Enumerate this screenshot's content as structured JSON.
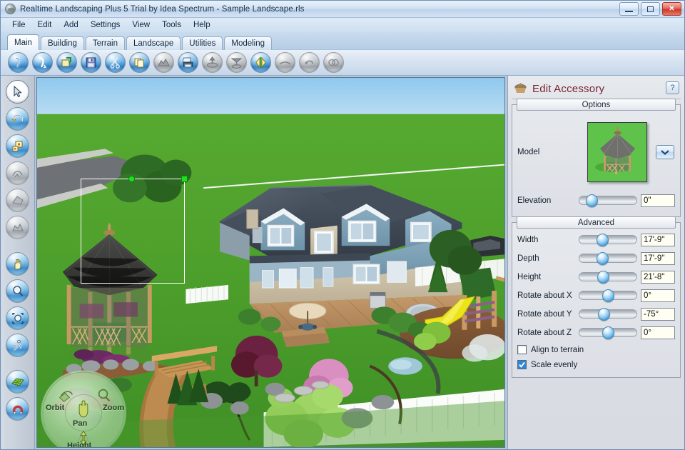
{
  "window": {
    "title": "Realtime Landscaping Plus 5 Trial by Idea Spectrum - Sample Landscape.rls",
    "app_icon": "globe-icon",
    "minimize_label": "Minimize",
    "maximize_label": "Maximize",
    "close_label": "✕"
  },
  "menu": {
    "items": [
      {
        "label": "File"
      },
      {
        "label": "Edit"
      },
      {
        "label": "Add"
      },
      {
        "label": "Settings"
      },
      {
        "label": "View"
      },
      {
        "label": "Tools"
      },
      {
        "label": "Help"
      }
    ]
  },
  "tabs": {
    "active": "Main",
    "items": [
      {
        "label": "Main",
        "active": true
      },
      {
        "label": "Building",
        "active": false
      },
      {
        "label": "Terrain",
        "active": false
      },
      {
        "label": "Landscape",
        "active": false
      },
      {
        "label": "Utilities",
        "active": false
      },
      {
        "label": "Modeling",
        "active": false
      }
    ]
  },
  "toolbar": {
    "buttons": [
      {
        "name": "new-project-icon",
        "tip": "New",
        "enabled": true
      },
      {
        "name": "open-project-icon",
        "tip": "Open",
        "enabled": true
      },
      {
        "name": "import-icon",
        "tip": "Import",
        "enabled": true
      },
      {
        "name": "save-icon",
        "tip": "Save",
        "enabled": true
      },
      {
        "name": "cut-icon",
        "tip": "Cut",
        "enabled": true
      },
      {
        "name": "copy-icon",
        "tip": "Copy",
        "enabled": true
      },
      {
        "name": "paste-icon",
        "tip": "Paste",
        "enabled": false
      },
      {
        "name": "print-icon",
        "tip": "Print",
        "enabled": true
      },
      {
        "name": "raise-object-icon",
        "tip": "Raise",
        "enabled": false
      },
      {
        "name": "lower-object-icon",
        "tip": "Lower",
        "enabled": false
      },
      {
        "name": "mirror-icon",
        "tip": "Mirror",
        "enabled": true
      },
      {
        "name": "flatten-icon",
        "tip": "Flatten",
        "enabled": false
      },
      {
        "name": "undo-icon",
        "tip": "Undo",
        "enabled": false
      },
      {
        "name": "redo-icon",
        "tip": "Redo",
        "enabled": false
      }
    ]
  },
  "tool_rail": {
    "buttons": [
      {
        "name": "select-arrow-tool",
        "state": "selected"
      },
      {
        "name": "rotate-tool",
        "state": "enabled"
      },
      {
        "name": "copy-object-tool",
        "state": "enabled"
      },
      {
        "name": "draw-region-tool",
        "state": "disabled"
      },
      {
        "name": "polygon-tool",
        "state": "disabled"
      },
      {
        "name": "freeform-tool",
        "state": "disabled"
      },
      {
        "name": "pan-hand-tool",
        "state": "enabled"
      },
      {
        "name": "zoom-tool",
        "state": "enabled"
      },
      {
        "name": "zoom-extents-tool",
        "state": "enabled"
      },
      {
        "name": "walkthrough-tool",
        "state": "enabled"
      },
      {
        "name": "grid-tool",
        "state": "enabled"
      },
      {
        "name": "magnet-snap-tool",
        "state": "enabled"
      }
    ]
  },
  "viewport": {
    "scene_description": "3D rendered landscape with two-story blue-sided house, wooden deck, gazebo, playground with yellow slide, white picket fence, trees, shrubs and garden beds",
    "selected_object": "gazebo",
    "nav_gizmo": {
      "orbit_label": "Orbit",
      "zoom_label": "Zoom",
      "pan_label": "Pan",
      "height_label": "Height"
    }
  },
  "panel": {
    "title": "Edit Accessory",
    "icon": "accessory-thumbnail-icon",
    "help_label": "?",
    "groups": [
      {
        "title": "Options",
        "model_label": "Model",
        "model_thumbnail": "gazebo-thumbnail",
        "dropdown_icon": "chevron-down-icon",
        "elevation": {
          "label": "Elevation",
          "value": "0\"",
          "slider_pct": 21
        }
      },
      {
        "title": "Advanced",
        "rows": [
          {
            "label": "Width",
            "value": "17'-9\"",
            "slider_pct": 40
          },
          {
            "label": "Depth",
            "value": "17'-9\"",
            "slider_pct": 40
          },
          {
            "label": "Height",
            "value": "21'-8\"",
            "slider_pct": 41
          },
          {
            "label": "Rotate about X",
            "value": "0°",
            "slider_pct": 50
          },
          {
            "label": "Rotate about Y",
            "value": "-75°",
            "slider_pct": 43
          },
          {
            "label": "Rotate about Z",
            "value": "0°",
            "slider_pct": 50
          }
        ],
        "checkboxes": [
          {
            "label": "Align to terrain",
            "checked": false
          },
          {
            "label": "Scale evenly",
            "checked": true
          }
        ]
      }
    ]
  },
  "colors": {
    "title_accent": "#7a2431",
    "grass": "#4fa331",
    "roof": "#3b4450",
    "siding": "#7ba0b4",
    "slide_yellow": "#ece417",
    "selection_handle": "#22dd22",
    "panel_bg": "#dcdfe5",
    "chrome_blue": "#b9d0e8"
  }
}
